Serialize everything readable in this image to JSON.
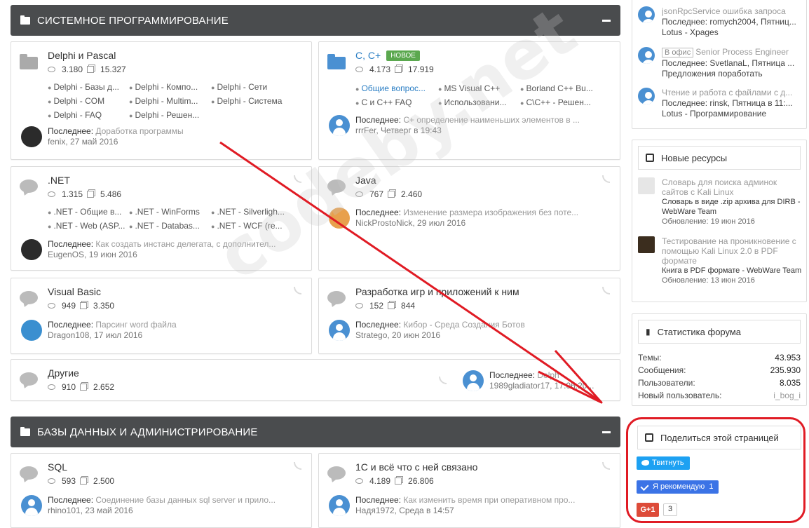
{
  "sections": [
    {
      "title": "СИСТЕМНОЕ ПРОГРАММИРОВАНИЕ"
    },
    {
      "title": "БАЗЫ ДАННЫХ И АДМИНИСТРИРОВАНИЕ"
    }
  ],
  "forums": {
    "delphi": {
      "title": "Delphi и Pascal",
      "threads": "3.180",
      "messages": "15.327",
      "subs": [
        "Delphi - Базы д...",
        "Delphi - Компо...",
        "Delphi - Сети",
        "Delphi - COM",
        "Delphi - Multim...",
        "Delphi - Система",
        "Delphi - FAQ",
        "Delphi - Решен..."
      ],
      "last_label": "Последнее:",
      "last_thread": "Доработка программы",
      "last_user": "fenix",
      "last_date": "27 май 2016"
    },
    "cpp": {
      "title": "C, C+",
      "badge": "НОВОЕ",
      "threads": "4.173",
      "messages": "17.919",
      "subs": [
        "Общие вопрос...",
        "MS Visual C++",
        "Borland C++ Bu...",
        "C и C++ FAQ",
        "Использовани...",
        "C\\C++ - Решен..."
      ],
      "last_label": "Последнее:",
      "last_thread": "C+ определение наименьших элементов в ...",
      "last_user": "rrrFer",
      "last_date": "Четверг в 19:43"
    },
    "dotnet": {
      "title": ".NET",
      "threads": "1.315",
      "messages": "5.486",
      "subs": [
        ".NET - Общие в...",
        ".NET - WinForms",
        ".NET - Silverligh...",
        ".NET - Web (ASP...",
        ".NET - Databas...",
        ".NET - WCF (re..."
      ],
      "last_label": "Последнее:",
      "last_thread": "Как создать инстанс делегата, с дополнител...",
      "last_user": "EugenOS",
      "last_date": "19 июн 2016"
    },
    "java": {
      "title": "Java",
      "threads": "767",
      "messages": "2.460",
      "last_label": "Последнее:",
      "last_thread": "Изменение размера изображения без поте...",
      "last_user": "NickProstoNick",
      "last_date": "29 июл 2016"
    },
    "vb": {
      "title": "Visual Basic",
      "threads": "949",
      "messages": "3.350",
      "last_label": "Последнее:",
      "last_thread": "Парсинг word файла",
      "last_user": "Dragon108",
      "last_date": "17 июл 2016"
    },
    "games": {
      "title": "Разработка игр и приложений к ним",
      "threads": "152",
      "messages": "844",
      "last_label": "Последнее:",
      "last_thread": "Кибор - Среда Создания Ботов",
      "last_user": "Stratego",
      "last_date": "20 июн 2016"
    },
    "other": {
      "title": "Другие",
      "threads": "910",
      "messages": "2.652",
      "last_label": "Последнее:",
      "last_thread": "Delph",
      "last_user": "1989gladiator17",
      "last_date": "17.06.20..."
    },
    "sql": {
      "title": "SQL",
      "threads": "593",
      "messages": "2.500",
      "last_label": "Последнее:",
      "last_thread": "Соединение базы данных sql server и прило...",
      "last_user": "rhino101",
      "last_date": "23 май 2016"
    },
    "onec": {
      "title": "1С и всё что с ней связано",
      "threads": "4.189",
      "messages": "26.806",
      "last_label": "Последнее:",
      "last_thread": "Как изменить время при оперативном про...",
      "last_user": "Надя1972",
      "last_date": "Среда в 14:57"
    }
  },
  "sidebar": {
    "recent_threads": [
      {
        "title": "jsonRpcService ошибка запроса",
        "last": "Последнее: romych2004, Пятниц...",
        "forum": "Lotus - Xpages"
      },
      {
        "prefix": "В офис",
        "title": "Senior Process Engineer",
        "last": "Последнее: SvetlanaL, Пятница ...",
        "forum": "Предложения поработать"
      },
      {
        "title": "Чтение и работа с файлами с д...",
        "last": "Последнее: rinsk, Пятница в 11:...",
        "forum": "Lotus - Программирование"
      }
    ],
    "resources_title": "Новые ресурсы",
    "resources": [
      {
        "title": "Словарь для поиска админок сайтов с Kali Linux",
        "desc": "Словарь в виде .zip архива для DIRB - WebWare Team",
        "updated": "Обновление: 19 июн 2016"
      },
      {
        "title": "Тестирование на проникновение с помощью Kali Linux 2.0 в PDF формате",
        "desc": "Книга в PDF формате - WebWare Team",
        "updated": "Обновление: 13 июн 2016"
      }
    ],
    "stats_title": "Статистика форума",
    "stats": [
      {
        "label": "Темы:",
        "value": "43.953"
      },
      {
        "label": "Сообщения:",
        "value": "235.930"
      },
      {
        "label": "Пользователи:",
        "value": "8.035"
      },
      {
        "label": "Новый пользователь:",
        "value": "i_bog_i"
      }
    ],
    "share_title": "Поделиться этой страницей",
    "tweet_label": "Твитнуть",
    "recommend_label": "Я рекомендую",
    "recommend_count": "1",
    "gplus_label": "G+1",
    "gplus_count": "3"
  },
  "watermark": "codeby.net",
  "colors": {
    "annotation": "#e01b24",
    "category_bar": "#4a4c4e",
    "link": "#2a7ec4"
  }
}
